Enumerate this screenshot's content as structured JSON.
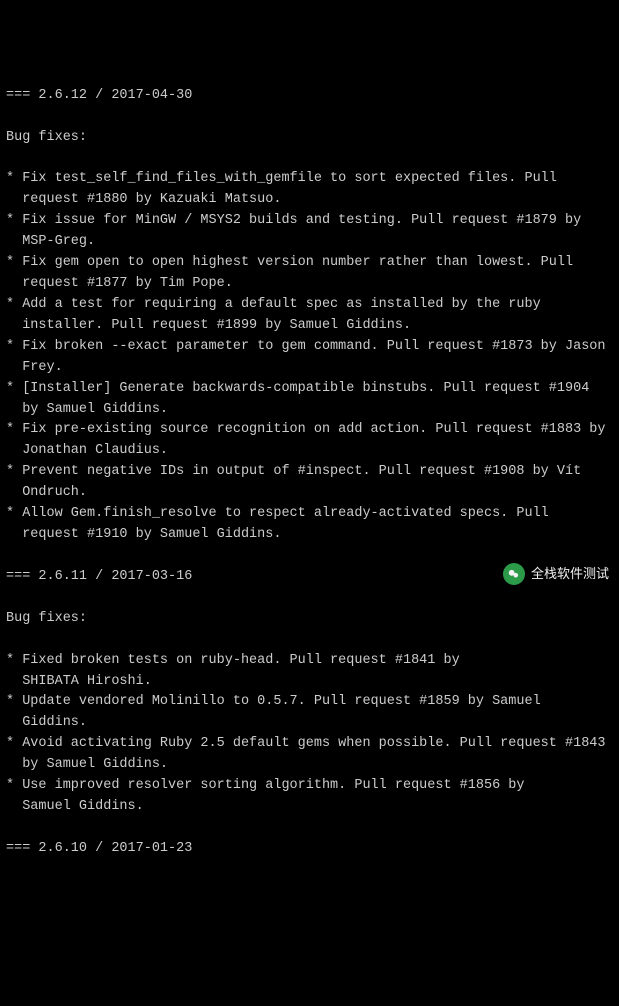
{
  "sections": [
    {
      "header": "=== 2.6.12 / 2017-04-30",
      "subheader": "Bug fixes:",
      "items": [
        "* Fix test_self_find_files_with_gemfile to sort expected files. Pull\n  request #1880 by Kazuaki Matsuo.",
        "* Fix issue for MinGW / MSYS2 builds and testing. Pull request #1879 by\n  MSP-Greg.",
        "* Fix gem open to open highest version number rather than lowest. Pull\n  request #1877 by Tim Pope.",
        "* Add a test for requiring a default spec as installed by the ruby\n  installer. Pull request #1899 by Samuel Giddins.",
        "* Fix broken --exact parameter to gem command. Pull request #1873 by Jason\n  Frey.",
        "* [Installer] Generate backwards-compatible binstubs. Pull request #1904\n  by Samuel Giddins.",
        "* Fix pre-existing source recognition on add action. Pull request #1883 by\n  Jonathan Claudius.",
        "* Prevent negative IDs in output of #inspect. Pull request #1908 by Vít\n  Ondruch.",
        "* Allow Gem.finish_resolve to respect already-activated specs. Pull\n  request #1910 by Samuel Giddins."
      ]
    },
    {
      "header": "=== 2.6.11 / 2017-03-16",
      "subheader": "Bug fixes:",
      "items": [
        "* Fixed broken tests on ruby-head. Pull request #1841 by\n  SHIBATA Hiroshi.",
        "* Update vendored Molinillo to 0.5.7. Pull request #1859 by Samuel\n  Giddins.",
        "* Avoid activating Ruby 2.5 default gems when possible. Pull request #1843\n  by Samuel Giddins.",
        "* Use improved resolver sorting algorithm. Pull request #1856 by\n  Samuel Giddins."
      ]
    },
    {
      "header": "=== 2.6.10 / 2017-01-23",
      "subheader": "",
      "items": []
    }
  ],
  "watermark": {
    "label": "全栈软件测试"
  }
}
